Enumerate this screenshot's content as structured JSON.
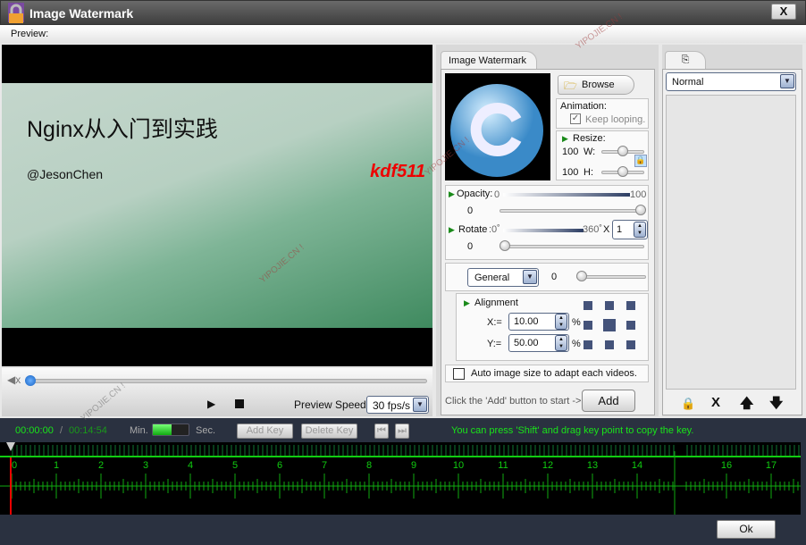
{
  "window": {
    "title": "Image Watermark",
    "close_label": "X"
  },
  "menu": {
    "preview_label": "Preview:"
  },
  "preview": {
    "slide_title": "Nginx从入门到实践",
    "slide_author": "@JesonChen",
    "slide_watermark": "kdf511",
    "playback_position": 0
  },
  "controls": {
    "preview_speed_label": "Preview Speed:",
    "preview_speed_value": "30 fps/s"
  },
  "watermark_panel": {
    "tab_label": "Image Watermark",
    "browse_label": "Browse",
    "animation_label": "Animation:",
    "keep_looping_label": "Keep looping.",
    "keep_looping_checked": true,
    "resize_label": "Resize:",
    "width_value": "100",
    "width_label": "W:",
    "height_value": "100",
    "height_label": "H:",
    "opacity_label": "Opacity:",
    "opacity_min": "0",
    "opacity_max": "100",
    "opacity_value": "0",
    "rotate_label": "Rotate",
    "rotate_min": ":0˚",
    "rotate_max": "360˚",
    "rotate_times_label": "X",
    "rotate_times": "1",
    "rotate_value": "0",
    "mode_value": "General",
    "mode_amount": "0",
    "alignment_label": "Alignment",
    "x_label": "X:=",
    "x_value": "10.00",
    "y_label": "Y:=",
    "y_value": "50.00",
    "percent": "%",
    "auto_size_label": "Auto image size to adapt each videos.",
    "auto_size_checked": false,
    "hint": "Click the 'Add' button to start ->",
    "add_label": "Add"
  },
  "layer_panel": {
    "blend_value": "Normal",
    "actions": [
      "lock-icon",
      "X",
      "arrow-up-icon",
      "arrow-down-icon"
    ],
    "delete_label": "X"
  },
  "timeline": {
    "current_time": "00:00:00",
    "separator": "/",
    "total_time": "00:14:54",
    "min_label": "Min.",
    "sec_label": "Sec.",
    "add_key_label": "Add Key",
    "delete_key_label": "Delete Key",
    "hint": "You can press 'Shift' and drag key point to copy the key.",
    "ruler_labels": [
      "0",
      "1",
      "2",
      "3",
      "4",
      "5",
      "6",
      "7",
      "8",
      "9",
      "10",
      "11",
      "12",
      "13",
      "14",
      "",
      "16",
      "17"
    ]
  },
  "footer": {
    "ok_label": "Ok"
  },
  "watermarks": {
    "text": "YIPOJIE.CN !"
  }
}
